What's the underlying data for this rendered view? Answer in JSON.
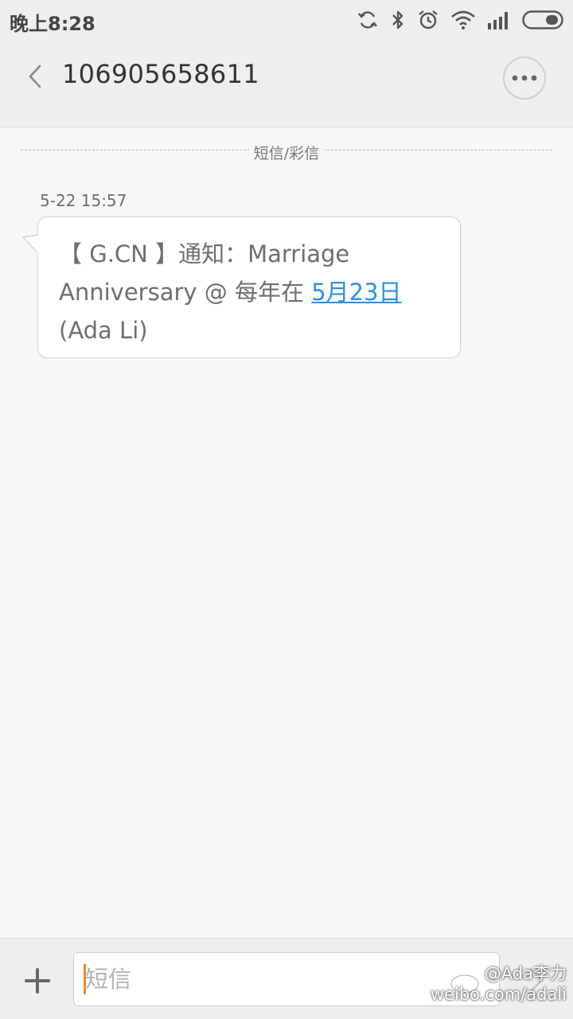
{
  "status_bar": {
    "time": "晚上8:28",
    "icons": [
      "sync-icon",
      "bluetooth-icon",
      "alarm-icon",
      "wifi-icon",
      "signal-icon",
      "battery-icon"
    ]
  },
  "header": {
    "title": "106905658611",
    "back_icon": "chevron-left-icon",
    "more_icon": "more-dots-icon"
  },
  "divider": {
    "label": "短信/彩信"
  },
  "message": {
    "timestamp": "5-22 15:57",
    "text_before_link": "【 G.CN 】通知：Marriage Anniversary @ 每年在 ",
    "link_text": "5月23日",
    "text_after_link": " (Ada Li)"
  },
  "input_bar": {
    "plus_icon": "plus-icon",
    "placeholder": "短信",
    "value": "",
    "send_icon": "send-chevron-icon"
  },
  "watermark": {
    "handle": "@Ada李力",
    "url": "weibo.com/adali"
  },
  "colors": {
    "background": "#f7f7f7",
    "bar": "#eeeeee",
    "link": "#2a8ef0",
    "caret": "#f08a24"
  }
}
